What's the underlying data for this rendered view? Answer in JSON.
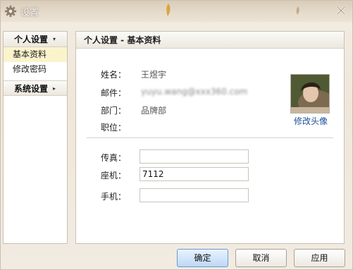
{
  "window": {
    "title": "设置",
    "close": "✕"
  },
  "sidebar": {
    "groups": [
      {
        "label": "个人设置",
        "arrow": "▾",
        "items": [
          "基本资料",
          "修改密码"
        ]
      },
      {
        "label": "系统设置",
        "arrow": "▸",
        "items": []
      }
    ]
  },
  "panel": {
    "title": "个人设置 - 基本资料",
    "profile": {
      "name_label": "姓名：",
      "name_value": "王煜宇",
      "email_label": "邮件：",
      "email_value": "yuyu.wang@xxx360.com",
      "dept_label": "部门：",
      "dept_value": "品牌部",
      "title_label": "职位：",
      "title_value": ""
    },
    "contact": {
      "fax_label": "传真：",
      "fax_value": "",
      "phone_label": "座机：",
      "phone_value": "7112",
      "mobile_label": "手机：",
      "mobile_value": ""
    },
    "avatar_link": "修改头像"
  },
  "buttons": {
    "ok": "确定",
    "cancel": "取消",
    "apply": "应用"
  },
  "icons": {
    "title": "gear-icon",
    "close": "close-icon",
    "avatar": "user-photo"
  },
  "colors": {
    "accent": "#1a4f9c",
    "active_item": "#fbf3cc",
    "primary_button": "#bdd8f6"
  }
}
